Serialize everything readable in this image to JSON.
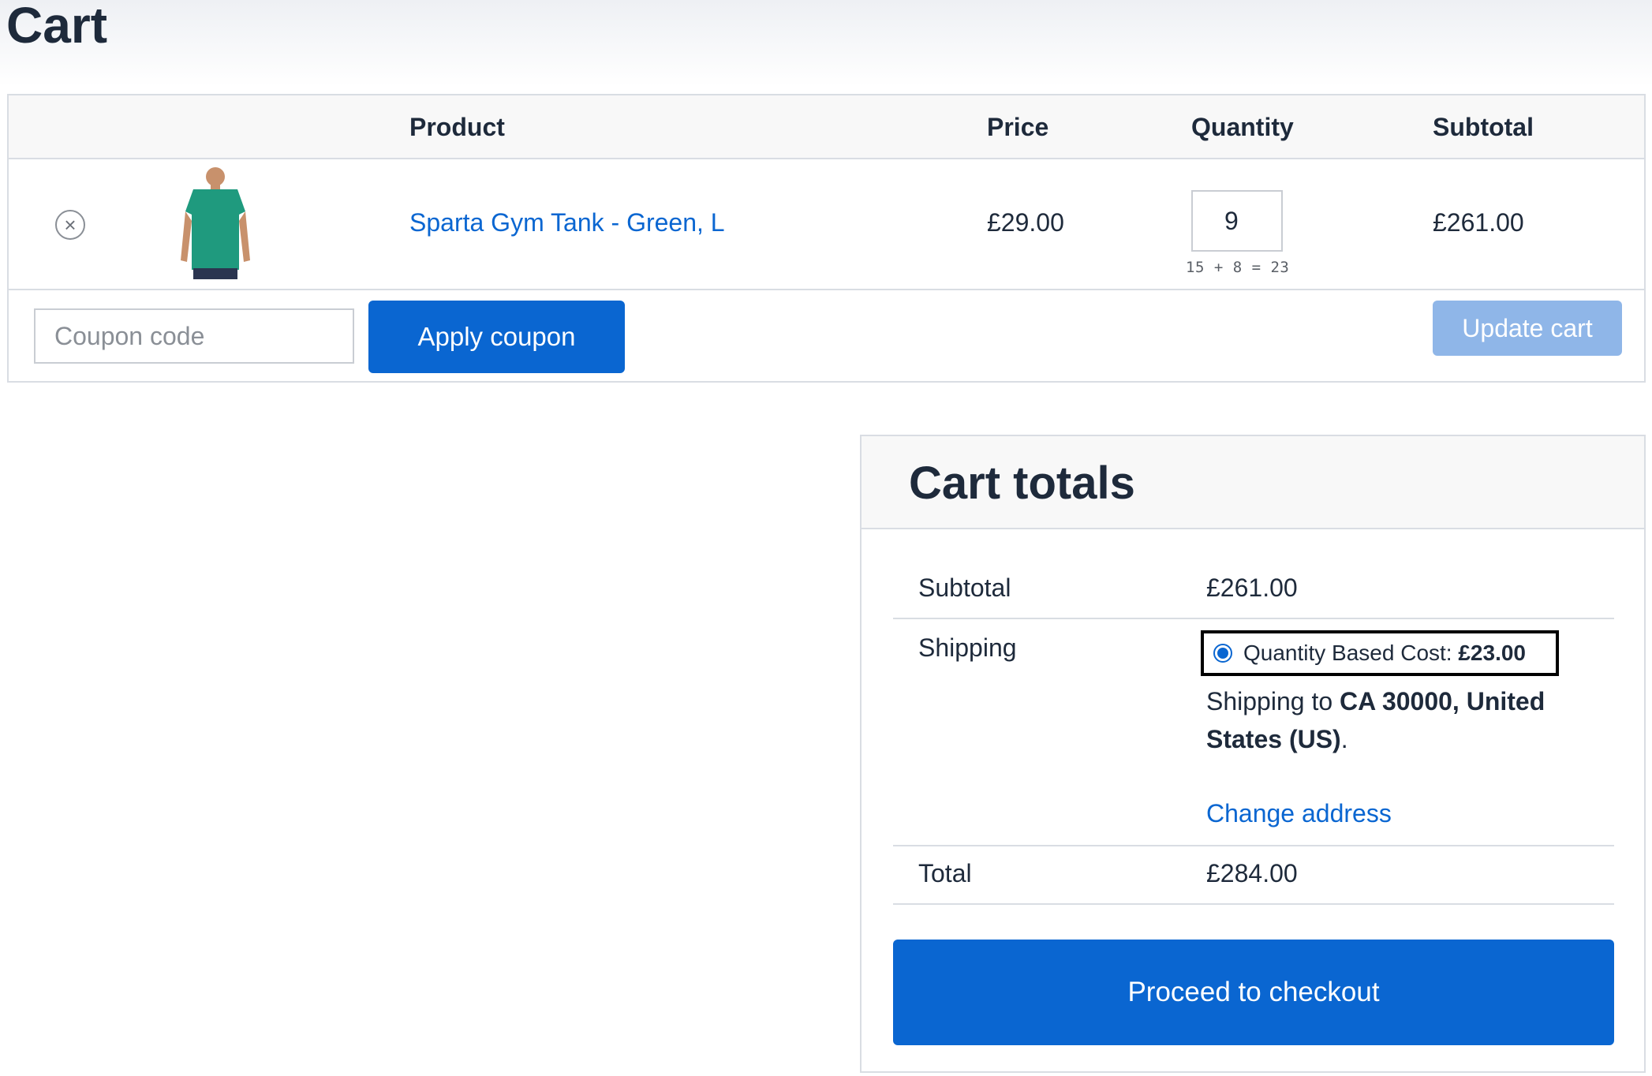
{
  "page": {
    "title": "Cart"
  },
  "cart_table": {
    "headers": {
      "product": "Product",
      "price": "Price",
      "quantity": "Quantity",
      "subtotal": "Subtotal"
    },
    "items": [
      {
        "name": "Sparta Gym Tank - Green, L",
        "price": "£29.00",
        "quantity": "9",
        "quantity_hint": "15 + 8 = 23",
        "subtotal": "£261.00",
        "remove_icon": "close-circle-icon",
        "image_color": "#1f9a7e"
      }
    ],
    "coupon": {
      "placeholder": "Coupon code",
      "apply_label": "Apply coupon"
    },
    "update_label": "Update cart"
  },
  "cart_totals": {
    "title": "Cart totals",
    "subtotal_label": "Subtotal",
    "subtotal_value": "£261.00",
    "shipping_label": "Shipping",
    "shipping_option_label": "Quantity Based Cost: ",
    "shipping_option_cost": "£23.00",
    "shipping_to_prefix": "Shipping to ",
    "shipping_destination": "CA 30000, United States (US)",
    "shipping_to_suffix": ".",
    "change_address": "Change address",
    "total_label": "Total",
    "total_value": "£284.00",
    "checkout_label": "Proceed to checkout"
  },
  "colors": {
    "accent": "#0a66d1",
    "accent_disabled": "#8fb6e8",
    "text": "#1e2a3b",
    "border": "#d9dde3"
  }
}
